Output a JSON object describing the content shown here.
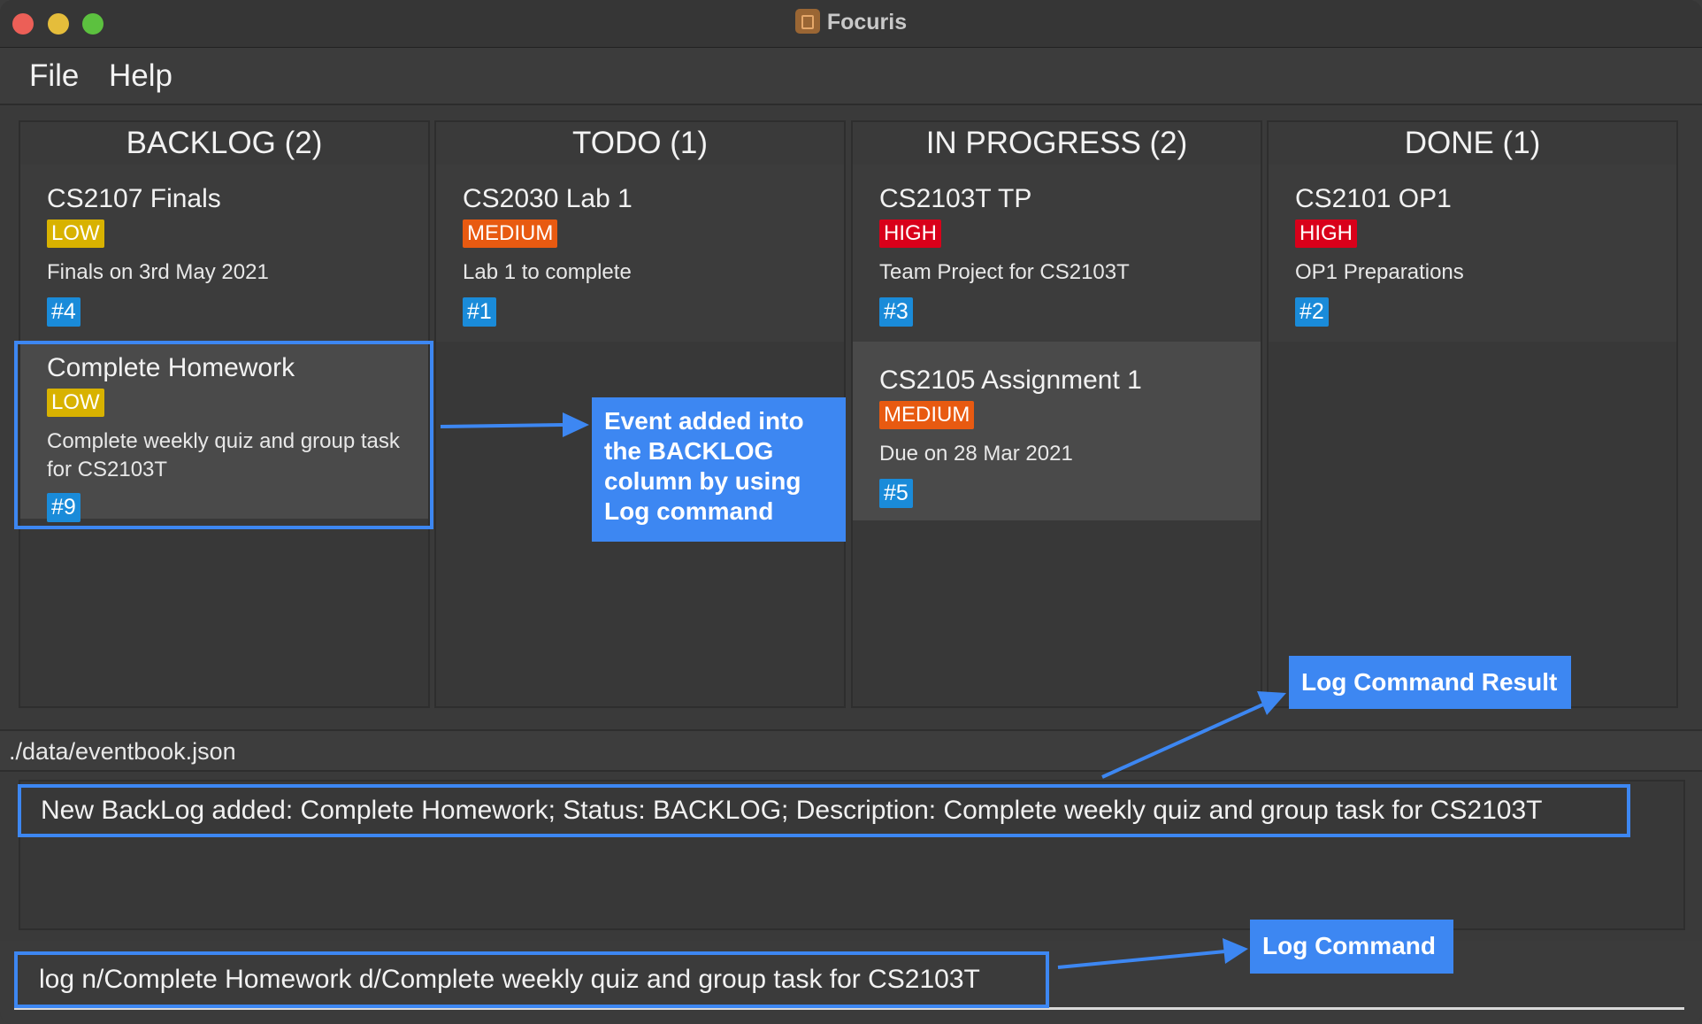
{
  "window": {
    "title": "Focuris"
  },
  "menu": {
    "file": "File",
    "help": "Help"
  },
  "columns": [
    {
      "header": "BACKLOG (2)",
      "cards": [
        {
          "title": "CS2107 Finals",
          "priority": "LOW",
          "description": "Finals on 3rd May 2021",
          "id": "#4"
        },
        {
          "title": "Complete Homework",
          "priority": "LOW",
          "description": "Complete weekly quiz and group task for CS2103T",
          "id": "#9"
        }
      ]
    },
    {
      "header": "TODO (1)",
      "cards": [
        {
          "title": "CS2030 Lab 1",
          "priority": "MEDIUM",
          "description": "Lab 1 to complete",
          "id": "#1"
        }
      ]
    },
    {
      "header": "IN PROGRESS (2)",
      "cards": [
        {
          "title": "CS2103T TP",
          "priority": "HIGH",
          "description": "Team Project for CS2103T",
          "id": "#3"
        },
        {
          "title": "CS2105 Assignment 1",
          "priority": "MEDIUM",
          "description": "Due on 28 Mar 2021",
          "id": "#5"
        }
      ]
    },
    {
      "header": "DONE (1)",
      "cards": [
        {
          "title": "CS2101 OP1",
          "priority": "HIGH",
          "description": "OP1 Preparations",
          "id": "#2"
        }
      ]
    }
  ],
  "status_bar": {
    "path": "./data/eventbook.json"
  },
  "result": {
    "text": "New BackLog added: Complete Homework; Status: BACKLOG; Description: Complete weekly quiz and group task for CS2103T"
  },
  "command": {
    "value": "log n/Complete Homework d/Complete weekly quiz and group task for CS2103T"
  },
  "annotations": {
    "event_added": "Event added into the BACKLOG column by using Log command",
    "result_label": "Log Command Result",
    "command_label": "Log Command"
  },
  "colors": {
    "low": "#d8b200",
    "medium": "#e85a11",
    "high": "#d9001a",
    "id_badge": "#1a8bd9",
    "annotation": "#3d87f2"
  }
}
